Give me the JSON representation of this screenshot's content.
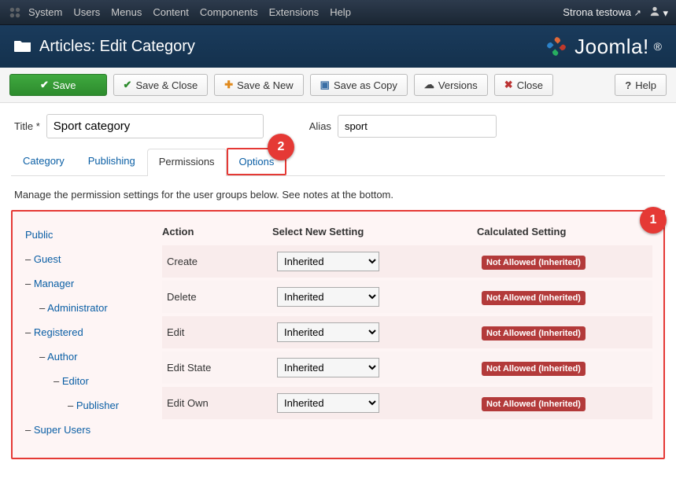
{
  "topmenu": {
    "items": [
      "System",
      "Users",
      "Menus",
      "Content",
      "Components",
      "Extensions",
      "Help"
    ],
    "site": "Strona testowa"
  },
  "header": {
    "title": "Articles: Edit Category",
    "logo_text": "Joomla!"
  },
  "toolbar": {
    "save": "Save",
    "save_close": "Save & Close",
    "save_new": "Save & New",
    "save_copy": "Save as Copy",
    "versions": "Versions",
    "close": "Close",
    "help": "Help"
  },
  "fields": {
    "title_label": "Title *",
    "title_value": "Sport category",
    "alias_label": "Alias",
    "alias_value": "sport"
  },
  "tabs": {
    "category": "Category",
    "publishing": "Publishing",
    "permissions": "Permissions",
    "options": "Options"
  },
  "note": "Manage the permission settings for the user groups below. See notes at the bottom.",
  "groups": [
    {
      "label": "Public",
      "level": 0,
      "dash": false
    },
    {
      "label": "Guest",
      "level": 0,
      "dash": true
    },
    {
      "label": "Manager",
      "level": 0,
      "dash": true
    },
    {
      "label": "Administrator",
      "level": 1,
      "dash": true
    },
    {
      "label": "Registered",
      "level": 0,
      "dash": true
    },
    {
      "label": "Author",
      "level": 1,
      "dash": true
    },
    {
      "label": "Editor",
      "level": 2,
      "dash": true
    },
    {
      "label": "Publisher",
      "level": 3,
      "dash": true
    },
    {
      "label": "Super Users",
      "level": 0,
      "dash": true
    }
  ],
  "perm_head": {
    "action": "Action",
    "select": "Select New Setting",
    "calc": "Calculated Setting"
  },
  "perm_rows": [
    {
      "action": "Create",
      "setting": "Inherited",
      "calc": "Not Allowed (Inherited)"
    },
    {
      "action": "Delete",
      "setting": "Inherited",
      "calc": "Not Allowed (Inherited)"
    },
    {
      "action": "Edit",
      "setting": "Inherited",
      "calc": "Not Allowed (Inherited)"
    },
    {
      "action": "Edit State",
      "setting": "Inherited",
      "calc": "Not Allowed (Inherited)"
    },
    {
      "action": "Edit Own",
      "setting": "Inherited",
      "calc": "Not Allowed (Inherited)"
    }
  ],
  "markers": {
    "one": "1",
    "two": "2"
  }
}
